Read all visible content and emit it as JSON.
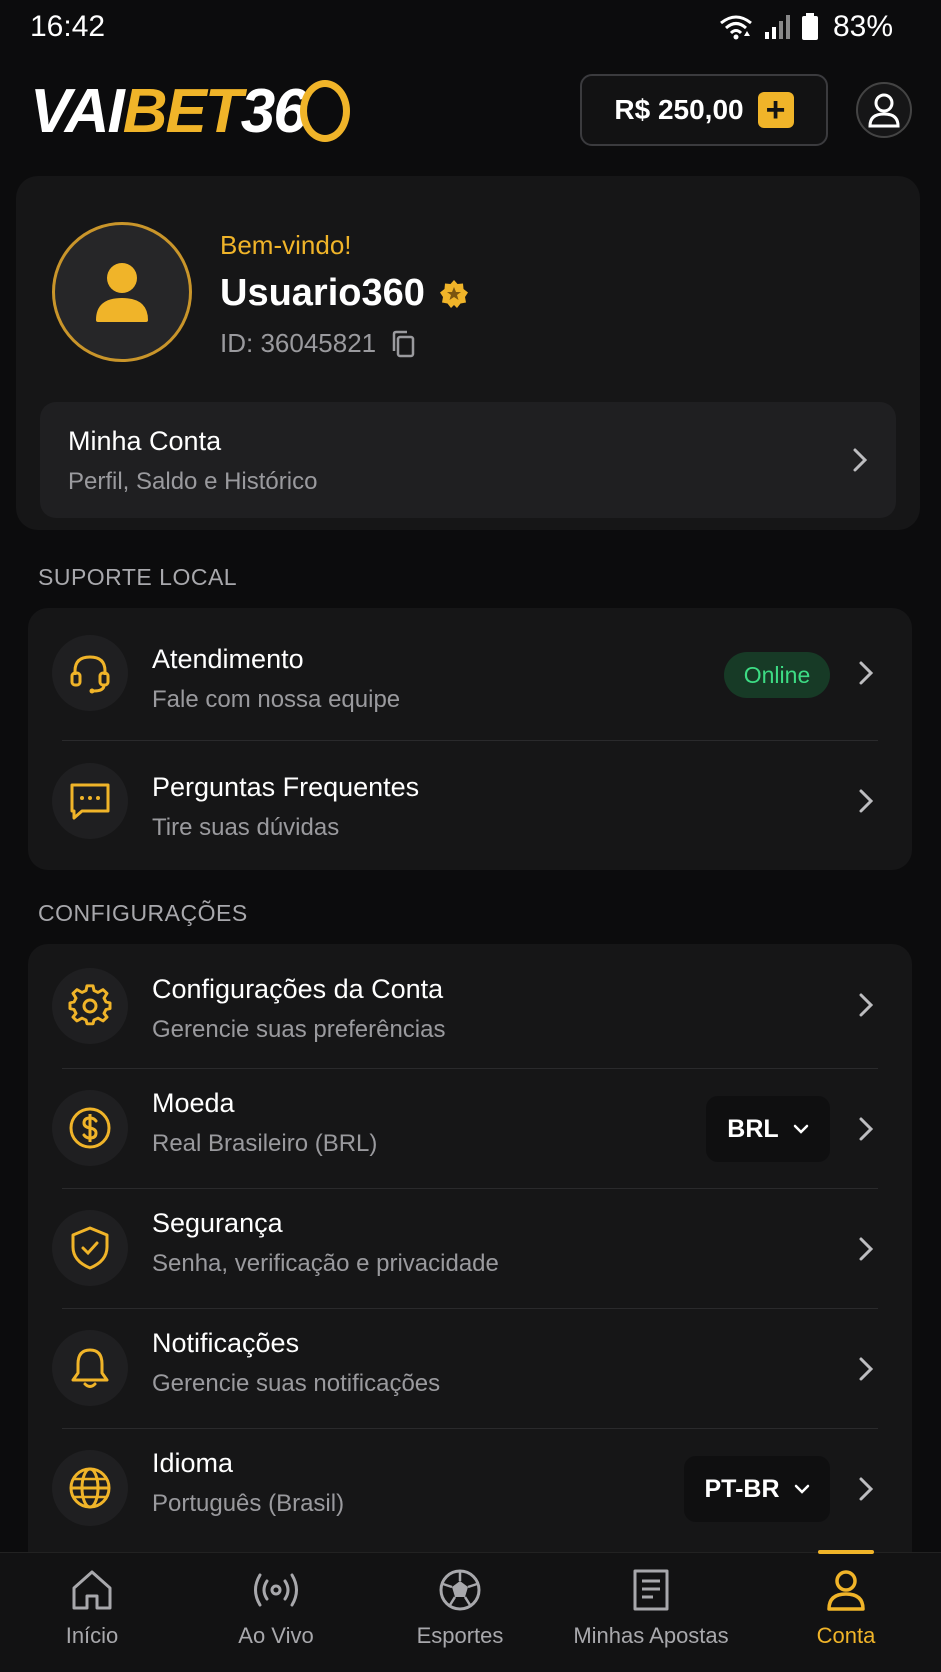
{
  "status": {
    "time": "16:42",
    "battery": "83%"
  },
  "header": {
    "logo": {
      "part1": "VAI",
      "part2": "BET",
      "part3": "36"
    },
    "balance": "R$ 250,00"
  },
  "user": {
    "welcome": "Bem-vindo!",
    "name": "Usuario360",
    "id": "ID: 36045821",
    "account": {
      "title": "Minha Conta",
      "subtitle": "Perfil, Saldo e Histórico"
    }
  },
  "support": {
    "title": "SUPORTE LOCAL",
    "items": [
      {
        "title": "Atendimento",
        "subtitle": "Fale com nossa equipe",
        "badge": "Online"
      },
      {
        "title": "Perguntas Frequentes",
        "subtitle": "Tire suas dúvidas"
      }
    ]
  },
  "settings": {
    "title": "CONFIGURAÇÕES",
    "items": [
      {
        "title": "Configurações da Conta",
        "subtitle": "Gerencie suas preferências"
      },
      {
        "title": "Moeda",
        "subtitle": "Real Brasileiro (BRL)",
        "value": "BRL"
      },
      {
        "title": "Segurança",
        "subtitle": "Senha, verificação e privacidade"
      },
      {
        "title": "Notificações",
        "subtitle": "Gerencie suas notificações"
      },
      {
        "title": "Idioma",
        "subtitle": "Português (Brasil)",
        "value": "PT-BR"
      }
    ]
  },
  "nav": {
    "items": [
      {
        "label": "Início"
      },
      {
        "label": "Ao Vivo"
      },
      {
        "label": "Esportes"
      },
      {
        "label": "Minhas Apostas"
      },
      {
        "label": "Conta"
      }
    ],
    "active": "Conta"
  },
  "colors": {
    "accent": "#f0b429",
    "online": "#3ddc84",
    "background": "#0c0c0d"
  }
}
